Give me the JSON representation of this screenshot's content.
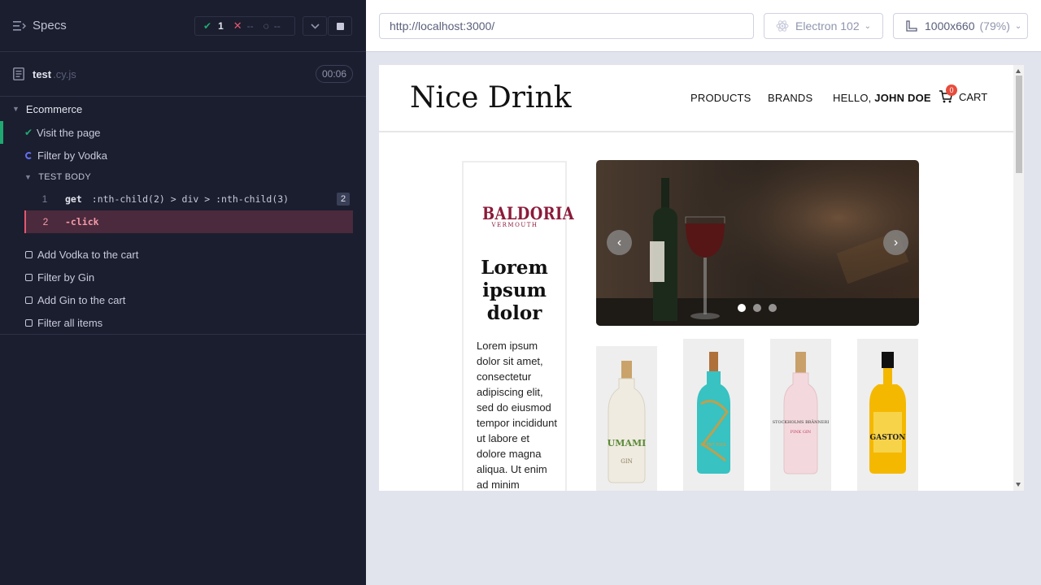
{
  "reporter": {
    "specs_title": "Specs",
    "stats": {
      "passed": "1",
      "failed": "--",
      "pending": "--"
    },
    "file": {
      "name": "test",
      "ext": ".cy.js",
      "duration": "00:06"
    },
    "suite": {
      "title": "Ecommerce"
    },
    "tests": [
      {
        "title": "Visit the page",
        "state": "passed"
      },
      {
        "title": "Filter by Vodka",
        "state": "running"
      }
    ],
    "test_body_label": "TEST BODY",
    "commands": [
      {
        "num": "1",
        "name": "get",
        "arg": ":nth-child(2) > div > :nth-child(3)",
        "badge": "2"
      },
      {
        "num": "2",
        "name": "-click",
        "arg": ""
      }
    ],
    "pending_tests": [
      {
        "title": "Add Vodka to the cart"
      },
      {
        "title": "Filter by Gin"
      },
      {
        "title": "Add Gin to the cart"
      },
      {
        "title": "Filter all items"
      }
    ]
  },
  "topbar": {
    "url": "http://localhost:3000/",
    "browser": "Electron 102",
    "viewport": "1000x660",
    "viewport_pct": "(79%)"
  },
  "site": {
    "logo": "Nice Drink",
    "nav": {
      "products": "PRODUCTS",
      "brands": "BRANDS",
      "hello_prefix": "HELLO,",
      "user_name": "JOHN DOE",
      "cart": "CART",
      "cart_count": "0"
    },
    "brand": {
      "logo_name": "BALDORIA",
      "logo_sub": "VERMOUTH",
      "heading": "Lorem ipsum dolor",
      "text": "Lorem ipsum dolor sit amet, consectetur adipiscing elit, sed do eiusmod tempor incididunt ut labore et dolore magna aliqua. Ut enim ad minim"
    },
    "carousel": {
      "prev_icon": "chevron-left-icon",
      "next_icon": "chevron-right-icon",
      "slides": 3,
      "active_slide": 1
    },
    "products": [
      {
        "label": "UMAMI",
        "sub": "GIN",
        "color": "#f2efe6"
      },
      {
        "label": "SILENT POOL",
        "sub": "",
        "color": "#3fc8c8"
      },
      {
        "label": "STOCKHOLMS BRÄNNERI",
        "sub": "PINK GIN",
        "color": "#f2d8dc"
      },
      {
        "label": "GASTON",
        "sub": "",
        "color": "#f5b800"
      }
    ]
  }
}
